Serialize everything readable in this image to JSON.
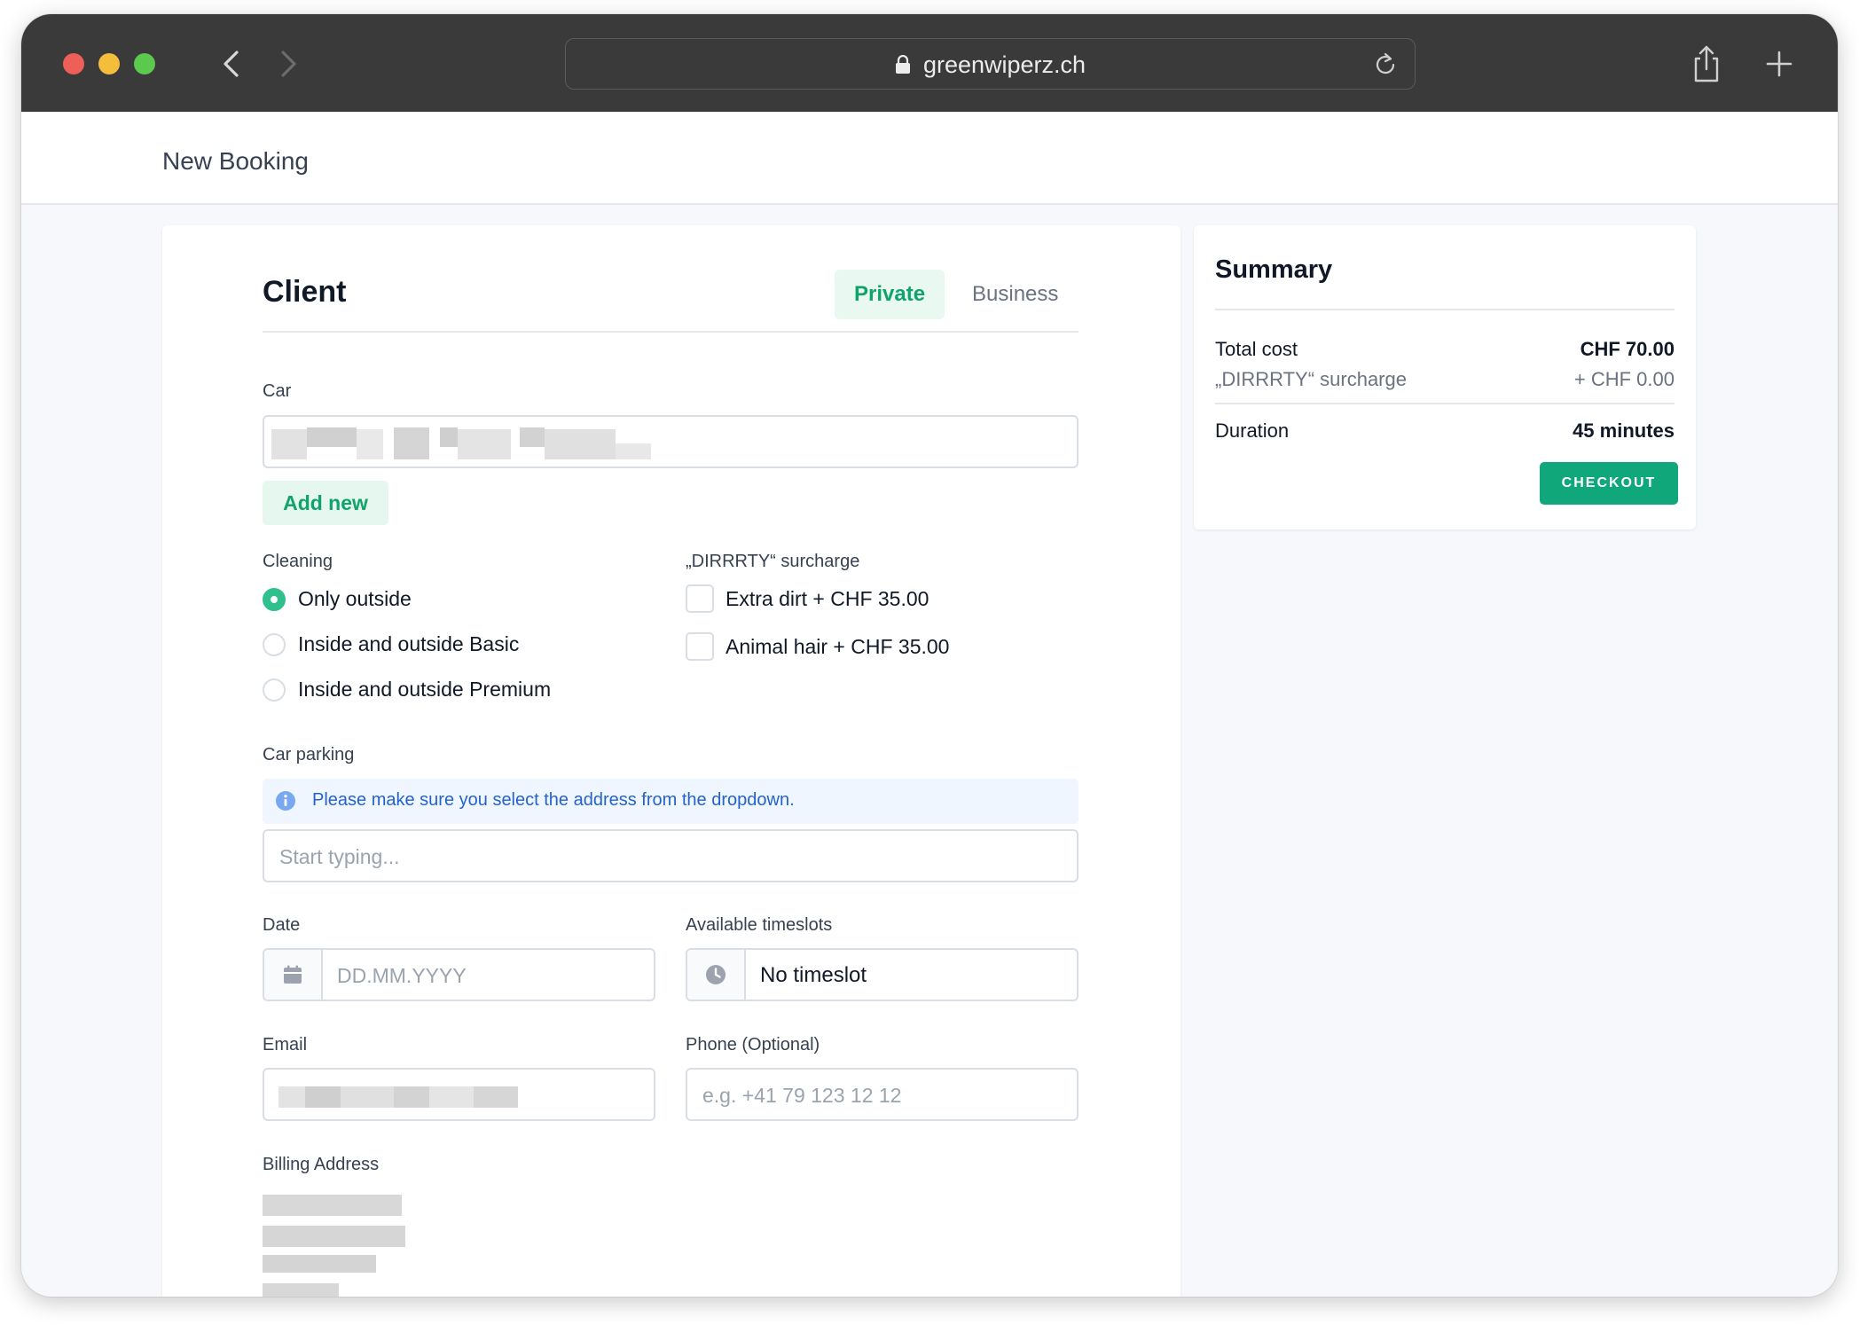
{
  "browser": {
    "url": "greenwiperz.ch"
  },
  "header": {
    "title": "New Booking"
  },
  "client": {
    "title": "Client",
    "tabs": [
      {
        "label": "Private",
        "active": true
      },
      {
        "label": "Business",
        "active": false
      }
    ]
  },
  "car": {
    "label": "Car",
    "add_label": "Add new"
  },
  "cleaning": {
    "label": "Cleaning",
    "options": [
      {
        "label": "Only outside",
        "selected": true
      },
      {
        "label": "Inside and outside Basic",
        "selected": false
      },
      {
        "label": "Inside and outside Premium",
        "selected": false
      }
    ]
  },
  "surcharge": {
    "label": "„DIRRRTY“ surcharge",
    "options": [
      {
        "label": "Extra dirt + CHF 35.00",
        "checked": false
      },
      {
        "label": "Animal hair + CHF 35.00",
        "checked": false
      }
    ]
  },
  "parking": {
    "label": "Car parking",
    "info": "Please make sure you select the address from the dropdown.",
    "placeholder": "Start typing..."
  },
  "date": {
    "label": "Date",
    "placeholder": "DD.MM.YYYY"
  },
  "timeslots": {
    "label": "Available timeslots",
    "value": "No timeslot"
  },
  "email": {
    "label": "Email"
  },
  "phone": {
    "label": "Phone (Optional)",
    "placeholder": "e.g. +41 79 123 12 12"
  },
  "billing": {
    "label": "Billing Address"
  },
  "summary": {
    "title": "Summary",
    "total_label": "Total cost",
    "total_value": "CHF 70.00",
    "surcharge_label": "„DIRRRTY“ surcharge",
    "surcharge_value": "+ CHF 0.00",
    "duration_label": "Duration",
    "duration_value": "45 minutes",
    "checkout_label": "CHECKOUT"
  },
  "colors": {
    "accent": "#10a77a",
    "chrome": "#3a3a3a",
    "info_bg": "#eff6ff",
    "info_text": "#2563c9"
  }
}
